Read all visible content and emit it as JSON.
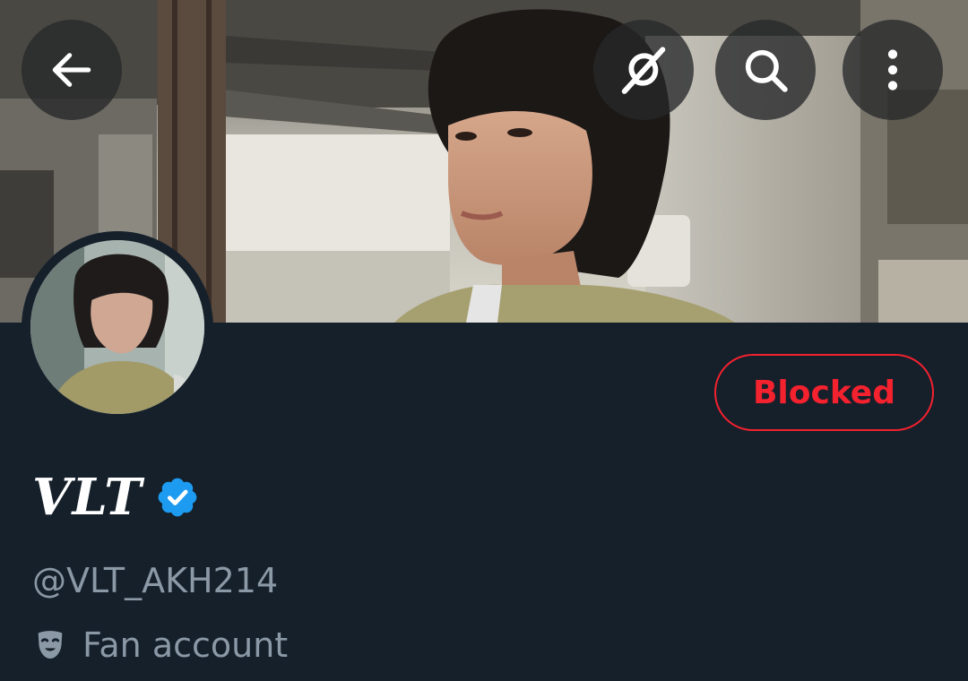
{
  "header": {
    "back_icon": "arrow-left-icon",
    "grok_icon": "grok-icon",
    "search_icon": "search-icon",
    "more_icon": "more-vertical-icon"
  },
  "profile": {
    "display_name": "VLT",
    "verified": true,
    "verified_color": "#1d9bf0",
    "handle": "@VLT_AKH214",
    "label": "Fan account",
    "label_icon": "theater-mask-icon"
  },
  "actions": {
    "blocked_label": "Blocked",
    "blocked_color": "#f4212e"
  },
  "theme": {
    "background": "#15202b",
    "secondary_text": "#8b98a5"
  }
}
